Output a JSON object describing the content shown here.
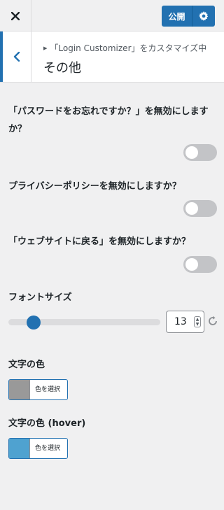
{
  "topbar": {
    "close_icon": "close-icon",
    "publish_label": "公開",
    "settings_icon": "gear-icon",
    "accent": "#2271b1"
  },
  "section": {
    "breadcrumb": "「Login Customizer」をカスタマイズ中",
    "title": "その他",
    "back_icon": "chevron-left-icon"
  },
  "controls": {
    "disable_lost_password": {
      "label": "「パスワードをお忘れですか？」を無効にしますか？",
      "enabled": false
    },
    "disable_privacy_policy": {
      "label": "プライバシーポリシーを無効にしますか？",
      "enabled": false
    },
    "disable_back_to_site": {
      "label": "「ウェブサイトに戻る」を無効にしますか？",
      "enabled": false
    },
    "font_size": {
      "label": "フォントサイズ",
      "value": "13"
    },
    "text_color": {
      "label": "文字の色",
      "button_label": "色を選択",
      "color": "#999999"
    },
    "text_color_hover": {
      "label": "文字の色 (hover)",
      "button_label": "色を選択",
      "color": "#4fa2d0"
    }
  }
}
